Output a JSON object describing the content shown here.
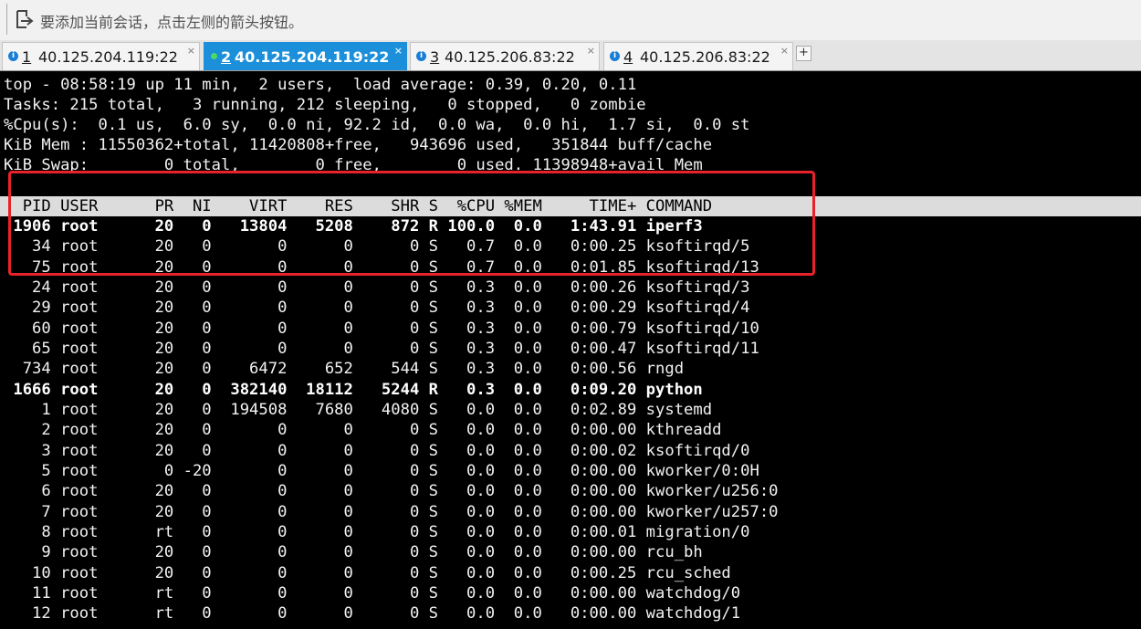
{
  "hint_bar": {
    "text": "要添加当前会话，点击左侧的箭头按钮。",
    "icon": "arrow-into-box-icon"
  },
  "tabs": [
    {
      "num": "1",
      "host": "40.125.204.119:22",
      "active": false
    },
    {
      "num": "2",
      "host": "40.125.204.119:22",
      "active": true
    },
    {
      "num": "3",
      "host": "40.125.206.83:22",
      "active": false
    },
    {
      "num": "4",
      "host": "40.125.206.83:22",
      "active": false
    }
  ],
  "tab_close_label": "×",
  "tab_add_label": "+",
  "terminal": {
    "summary": [
      "top - 08:58:19 up 11 min,  2 users,  load average: 0.39, 0.20, 0.11",
      "Tasks: 215 total,   3 running, 212 sleeping,   0 stopped,   0 zombie",
      "%Cpu(s):  0.1 us,  6.0 sy,  0.0 ni, 92.2 id,  0.0 wa,  0.0 hi,  1.7 si,  0.0 st",
      "KiB Mem : 11550362+total, 11420808+free,   943696 used,   351844 buff/cache",
      "KiB Swap:        0 total,        0 free,        0 used. 11398948+avail Mem"
    ],
    "columns": [
      "PID",
      "USER",
      "PR",
      "NI",
      "VIRT",
      "RES",
      "SHR",
      "S",
      "%CPU",
      "%MEM",
      "TIME+",
      "COMMAND"
    ],
    "header_line": "  PID USER      PR  NI    VIRT    RES    SHR S  %CPU %MEM     TIME+ COMMAND",
    "processes": [
      {
        "pid": "1906",
        "user": "root",
        "pr": "20",
        "ni": "0",
        "virt": "13804",
        "res": "5208",
        "shr": "872",
        "s": "R",
        "cpu": "100.0",
        "mem": "0.0",
        "time": "1:43.91",
        "cmd": "iperf3",
        "bold": true
      },
      {
        "pid": "34",
        "user": "root",
        "pr": "20",
        "ni": "0",
        "virt": "0",
        "res": "0",
        "shr": "0",
        "s": "S",
        "cpu": "0.7",
        "mem": "0.0",
        "time": "0:00.25",
        "cmd": "ksoftirqd/5",
        "bold": false
      },
      {
        "pid": "75",
        "user": "root",
        "pr": "20",
        "ni": "0",
        "virt": "0",
        "res": "0",
        "shr": "0",
        "s": "S",
        "cpu": "0.7",
        "mem": "0.0",
        "time": "0:01.85",
        "cmd": "ksoftirqd/13",
        "bold": false
      },
      {
        "pid": "24",
        "user": "root",
        "pr": "20",
        "ni": "0",
        "virt": "0",
        "res": "0",
        "shr": "0",
        "s": "S",
        "cpu": "0.3",
        "mem": "0.0",
        "time": "0:00.26",
        "cmd": "ksoftirqd/3",
        "bold": false
      },
      {
        "pid": "29",
        "user": "root",
        "pr": "20",
        "ni": "0",
        "virt": "0",
        "res": "0",
        "shr": "0",
        "s": "S",
        "cpu": "0.3",
        "mem": "0.0",
        "time": "0:00.29",
        "cmd": "ksoftirqd/4",
        "bold": false
      },
      {
        "pid": "60",
        "user": "root",
        "pr": "20",
        "ni": "0",
        "virt": "0",
        "res": "0",
        "shr": "0",
        "s": "S",
        "cpu": "0.3",
        "mem": "0.0",
        "time": "0:00.79",
        "cmd": "ksoftirqd/10",
        "bold": false
      },
      {
        "pid": "65",
        "user": "root",
        "pr": "20",
        "ni": "0",
        "virt": "0",
        "res": "0",
        "shr": "0",
        "s": "S",
        "cpu": "0.3",
        "mem": "0.0",
        "time": "0:00.47",
        "cmd": "ksoftirqd/11",
        "bold": false
      },
      {
        "pid": "734",
        "user": "root",
        "pr": "20",
        "ni": "0",
        "virt": "6472",
        "res": "652",
        "shr": "544",
        "s": "S",
        "cpu": "0.3",
        "mem": "0.0",
        "time": "0:00.56",
        "cmd": "rngd",
        "bold": false
      },
      {
        "pid": "1666",
        "user": "root",
        "pr": "20",
        "ni": "0",
        "virt": "382140",
        "res": "18112",
        "shr": "5244",
        "s": "R",
        "cpu": "0.3",
        "mem": "0.0",
        "time": "0:09.20",
        "cmd": "python",
        "bold": true
      },
      {
        "pid": "1",
        "user": "root",
        "pr": "20",
        "ni": "0",
        "virt": "194508",
        "res": "7680",
        "shr": "4080",
        "s": "S",
        "cpu": "0.0",
        "mem": "0.0",
        "time": "0:02.89",
        "cmd": "systemd",
        "bold": false
      },
      {
        "pid": "2",
        "user": "root",
        "pr": "20",
        "ni": "0",
        "virt": "0",
        "res": "0",
        "shr": "0",
        "s": "S",
        "cpu": "0.0",
        "mem": "0.0",
        "time": "0:00.00",
        "cmd": "kthreadd",
        "bold": false
      },
      {
        "pid": "3",
        "user": "root",
        "pr": "20",
        "ni": "0",
        "virt": "0",
        "res": "0",
        "shr": "0",
        "s": "S",
        "cpu": "0.0",
        "mem": "0.0",
        "time": "0:00.02",
        "cmd": "ksoftirqd/0",
        "bold": false
      },
      {
        "pid": "5",
        "user": "root",
        "pr": "0",
        "ni": "-20",
        "virt": "0",
        "res": "0",
        "shr": "0",
        "s": "S",
        "cpu": "0.0",
        "mem": "0.0",
        "time": "0:00.00",
        "cmd": "kworker/0:0H",
        "bold": false
      },
      {
        "pid": "6",
        "user": "root",
        "pr": "20",
        "ni": "0",
        "virt": "0",
        "res": "0",
        "shr": "0",
        "s": "S",
        "cpu": "0.0",
        "mem": "0.0",
        "time": "0:00.00",
        "cmd": "kworker/u256:0",
        "bold": false
      },
      {
        "pid": "7",
        "user": "root",
        "pr": "20",
        "ni": "0",
        "virt": "0",
        "res": "0",
        "shr": "0",
        "s": "S",
        "cpu": "0.0",
        "mem": "0.0",
        "time": "0:00.00",
        "cmd": "kworker/u257:0",
        "bold": false
      },
      {
        "pid": "8",
        "user": "root",
        "pr": "rt",
        "ni": "0",
        "virt": "0",
        "res": "0",
        "shr": "0",
        "s": "S",
        "cpu": "0.0",
        "mem": "0.0",
        "time": "0:00.01",
        "cmd": "migration/0",
        "bold": false
      },
      {
        "pid": "9",
        "user": "root",
        "pr": "20",
        "ni": "0",
        "virt": "0",
        "res": "0",
        "shr": "0",
        "s": "S",
        "cpu": "0.0",
        "mem": "0.0",
        "time": "0:00.00",
        "cmd": "rcu_bh",
        "bold": false
      },
      {
        "pid": "10",
        "user": "root",
        "pr": "20",
        "ni": "0",
        "virt": "0",
        "res": "0",
        "shr": "0",
        "s": "S",
        "cpu": "0.0",
        "mem": "0.0",
        "time": "0:00.25",
        "cmd": "rcu_sched",
        "bold": false
      },
      {
        "pid": "11",
        "user": "root",
        "pr": "rt",
        "ni": "0",
        "virt": "0",
        "res": "0",
        "shr": "0",
        "s": "S",
        "cpu": "0.0",
        "mem": "0.0",
        "time": "0:00.00",
        "cmd": "watchdog/0",
        "bold": false
      },
      {
        "pid": "12",
        "user": "root",
        "pr": "rt",
        "ni": "0",
        "virt": "0",
        "res": "0",
        "shr": "0",
        "s": "S",
        "cpu": "0.0",
        "mem": "0.0",
        "time": "0:00.00",
        "cmd": "watchdog/1",
        "bold": false
      }
    ]
  },
  "colors": {
    "terminal_bg": "#000000",
    "terminal_fg": "#f2f2f2",
    "header_row_bg": "#dcdcdc",
    "active_tab": "#1b8fd9",
    "highlight_box": "#e8222a"
  }
}
